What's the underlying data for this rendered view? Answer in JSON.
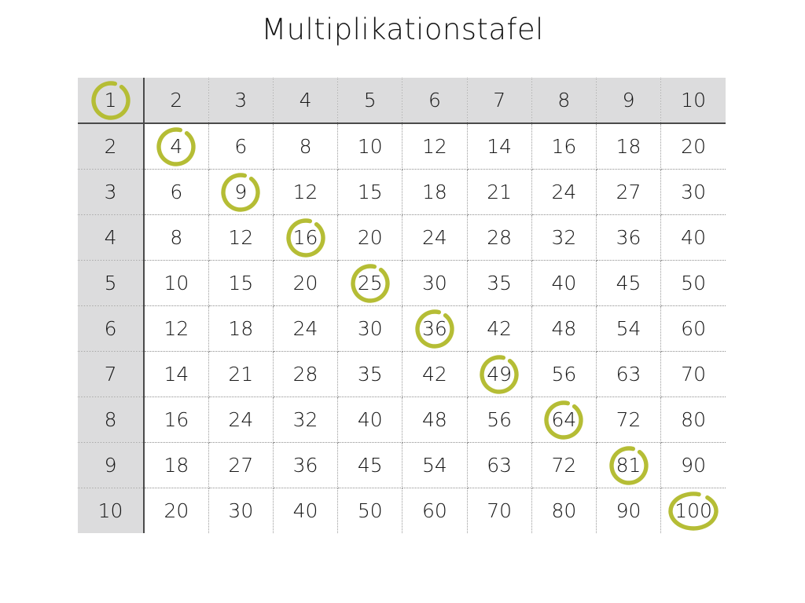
{
  "page": {
    "title": "Multiplikationstafel",
    "background_color": "#ffffff"
  },
  "colors": {
    "header_background": "#dcdcdd",
    "highlight_circle": "#b5bd35",
    "solid_rule": "#4a4a4a",
    "dotted_rule": "#9a9a9a",
    "text": "#151515"
  },
  "table": {
    "column_headers": [
      "1",
      "2",
      "3",
      "4",
      "5",
      "6",
      "7",
      "8",
      "9",
      "10"
    ],
    "row_headers": [
      "2",
      "3",
      "4",
      "5",
      "6",
      "7",
      "8",
      "9",
      "10"
    ],
    "highlighted_values": [
      "1",
      "4",
      "9",
      "16",
      "25",
      "36",
      "49",
      "64",
      "81",
      "100"
    ],
    "rows": [
      {
        "header": "2",
        "cells": [
          "4",
          "6",
          "8",
          "10",
          "12",
          "14",
          "16",
          "18",
          "20"
        ]
      },
      {
        "header": "3",
        "cells": [
          "6",
          "9",
          "12",
          "15",
          "18",
          "21",
          "24",
          "27",
          "30"
        ]
      },
      {
        "header": "4",
        "cells": [
          "8",
          "12",
          "16",
          "20",
          "24",
          "28",
          "32",
          "36",
          "40"
        ]
      },
      {
        "header": "5",
        "cells": [
          "10",
          "15",
          "20",
          "25",
          "30",
          "35",
          "40",
          "45",
          "50"
        ]
      },
      {
        "header": "6",
        "cells": [
          "12",
          "18",
          "24",
          "30",
          "36",
          "42",
          "48",
          "54",
          "60"
        ]
      },
      {
        "header": "7",
        "cells": [
          "14",
          "21",
          "28",
          "35",
          "42",
          "49",
          "56",
          "63",
          "70"
        ]
      },
      {
        "header": "8",
        "cells": [
          "16",
          "24",
          "32",
          "40",
          "48",
          "56",
          "64",
          "72",
          "80"
        ]
      },
      {
        "header": "9",
        "cells": [
          "18",
          "27",
          "36",
          "45",
          "54",
          "63",
          "72",
          "81",
          "90"
        ]
      },
      {
        "header": "10",
        "cells": [
          "20",
          "30",
          "40",
          "50",
          "60",
          "70",
          "80",
          "90",
          "100"
        ]
      }
    ]
  },
  "chart_data": {
    "type": "table",
    "title": "Multiplikationstafel",
    "xlabel": "",
    "ylabel": "",
    "categories": [
      "1",
      "2",
      "3",
      "4",
      "5",
      "6",
      "7",
      "8",
      "9",
      "10"
    ],
    "row_categories": [
      "2",
      "3",
      "4",
      "5",
      "6",
      "7",
      "8",
      "9",
      "10"
    ],
    "annotations": [
      "Perfect squares circled in olive green along the diagonal"
    ],
    "values": [
      [
        4,
        6,
        8,
        10,
        12,
        14,
        16,
        18,
        20
      ],
      [
        6,
        9,
        12,
        15,
        18,
        21,
        24,
        27,
        30
      ],
      [
        8,
        12,
        16,
        20,
        24,
        28,
        32,
        36,
        40
      ],
      [
        10,
        15,
        20,
        25,
        30,
        35,
        40,
        45,
        50
      ],
      [
        12,
        18,
        24,
        30,
        36,
        42,
        48,
        54,
        60
      ],
      [
        14,
        21,
        28,
        35,
        42,
        49,
        56,
        63,
        70
      ],
      [
        16,
        24,
        32,
        40,
        48,
        56,
        64,
        72,
        80
      ],
      [
        18,
        27,
        36,
        45,
        54,
        63,
        72,
        81,
        90
      ],
      [
        20,
        30,
        40,
        50,
        60,
        70,
        80,
        90,
        100
      ]
    ],
    "highlighted": [
      1,
      4,
      9,
      16,
      25,
      36,
      49,
      64,
      81,
      100
    ],
    "grid": true,
    "legend": "none"
  }
}
